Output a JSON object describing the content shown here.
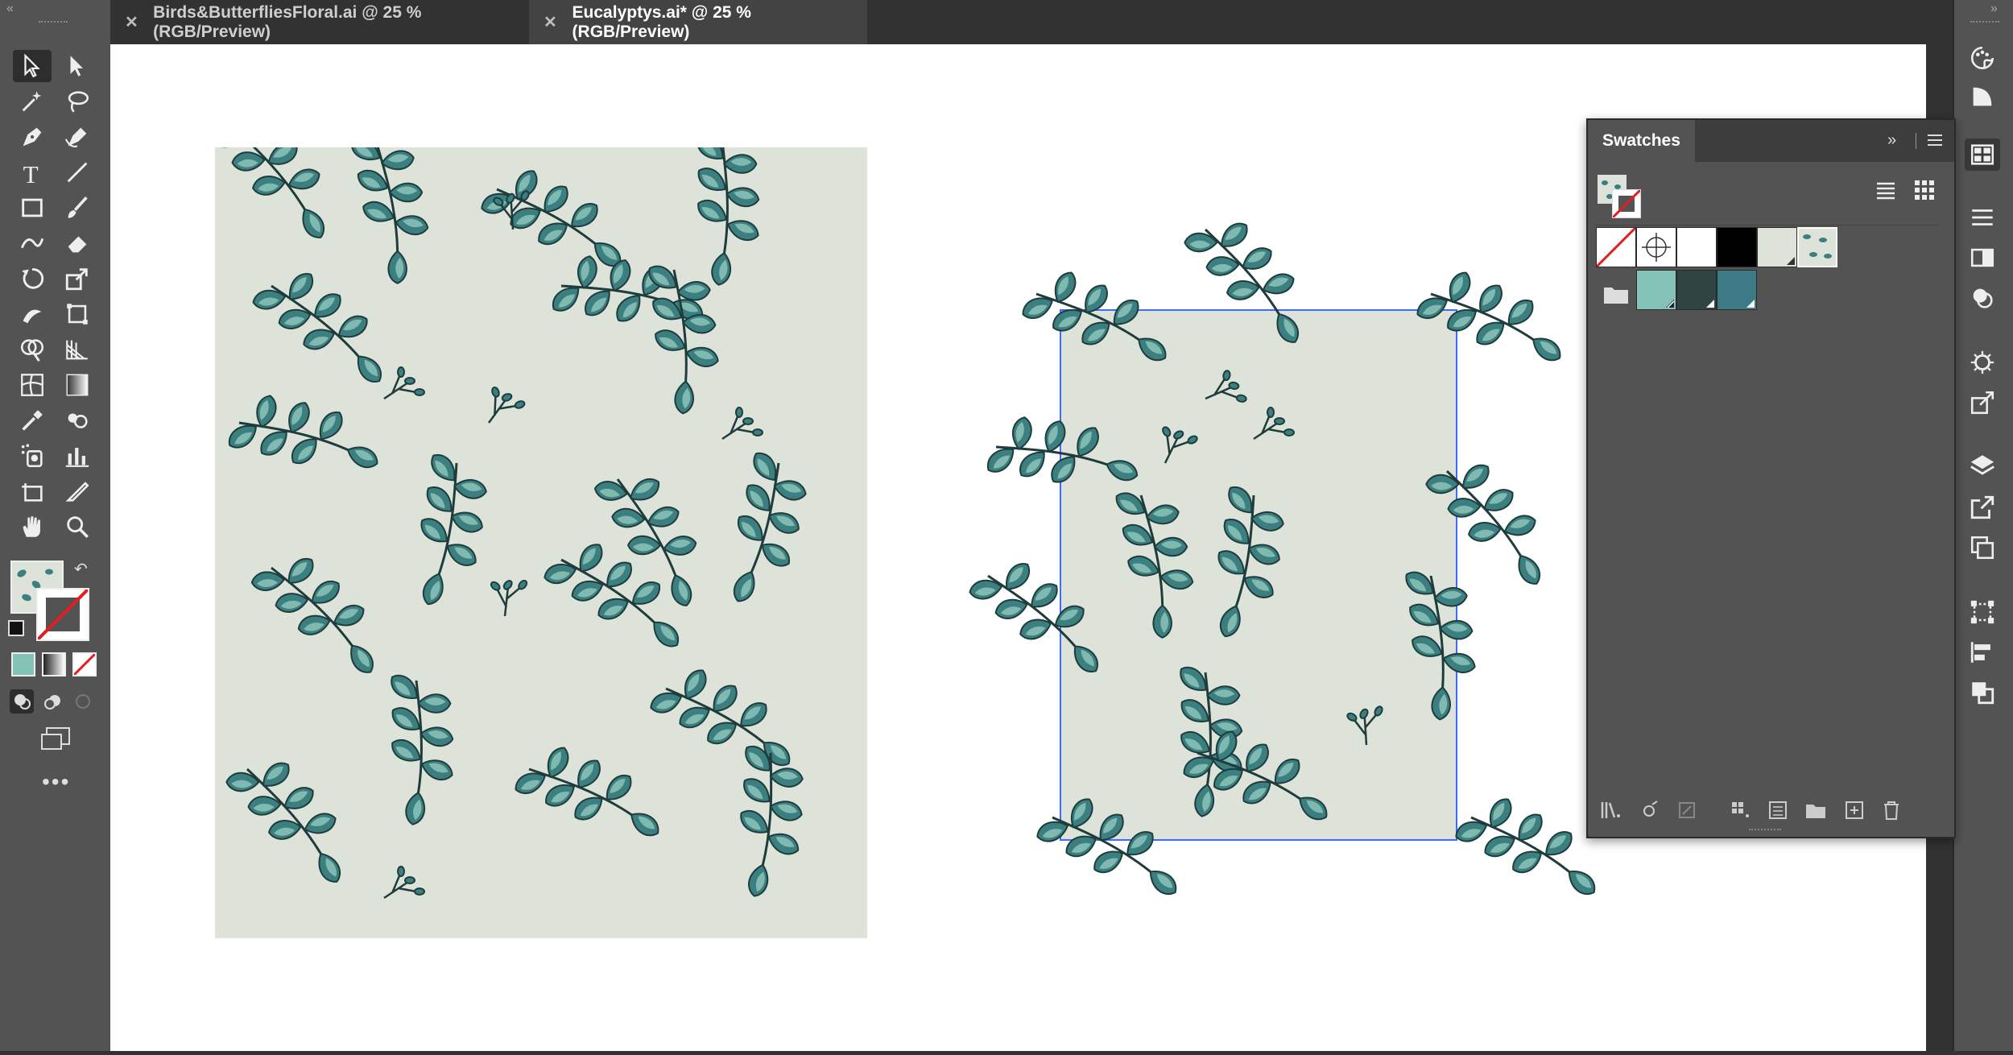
{
  "tabs": [
    {
      "label": "Birds&ButterfliesFloral.ai @ 25 % (RGB/Preview)",
      "active": false
    },
    {
      "label": "Eucalyptys.ai* @ 25 % (RGB/Preview)",
      "active": true
    }
  ],
  "swatches_panel": {
    "title": "Swatches",
    "row1": [
      "none",
      "registration",
      "#ffffff",
      "#000000",
      "#dde3d8",
      "pattern"
    ],
    "row2": [
      "#84c1b6",
      "#2f4542",
      "#3d7a85"
    ]
  },
  "colors": {
    "ui_dark": "#323232",
    "ui_mid": "#535353",
    "pattern_bg": "#dde3d8",
    "leaf_dark": "#3b7f80",
    "leaf_light": "#7fb9b0",
    "selection_blue": "#3d6bff"
  },
  "icons": {
    "toolbar": [
      "selection-tool-icon",
      "direct-selection-tool-icon",
      "magic-wand-icon",
      "lasso-icon",
      "pen-tool-icon",
      "curvature-tool-icon",
      "type-tool-icon",
      "line-tool-icon",
      "rectangle-tool-icon",
      "paintbrush-icon",
      "shaper-tool-icon",
      "eraser-icon",
      "rotate-tool-icon",
      "scale-tool-icon",
      "warp-tool-icon",
      "free-transform-icon",
      "shape-builder-icon",
      "perspective-grid-icon",
      "mesh-tool-icon",
      "gradient-tool-icon",
      "eyedropper-icon",
      "blend-tool-icon",
      "symbol-sprayer-icon",
      "column-graph-icon",
      "artboard-tool-icon",
      "slice-tool-icon",
      "hand-tool-icon",
      "zoom-tool-icon"
    ]
  }
}
